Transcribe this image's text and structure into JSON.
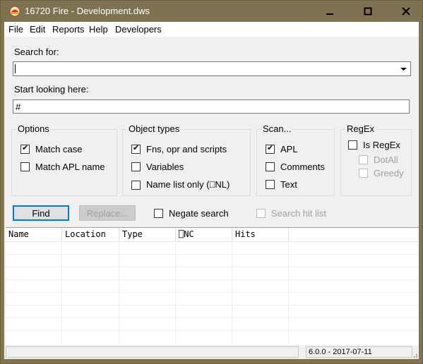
{
  "window": {
    "title": "16720 Fire - Development.dws"
  },
  "menu": {
    "items": [
      "File",
      "Edit",
      "Reports",
      "Help",
      "Developers"
    ]
  },
  "search": {
    "label": "Search for:",
    "value": ""
  },
  "start": {
    "label": "Start looking here:",
    "value": "#"
  },
  "options": {
    "title": "Options",
    "match_case": "Match case",
    "match_apl_name": "Match APL name",
    "match_case_checked": true,
    "match_apl_name_checked": false
  },
  "object_types": {
    "title": "Object types",
    "fns": "Fns, opr and scripts",
    "variables": "Variables",
    "namelist": "Name list only (⎕NL)",
    "fns_checked": true,
    "variables_checked": false,
    "namelist_checked": false
  },
  "scan": {
    "title": "Scan...",
    "apl": "APL",
    "comments": "Comments",
    "text": "Text",
    "apl_checked": true,
    "comments_checked": false,
    "text_checked": false
  },
  "regex": {
    "title": "RegEx",
    "is_regex": "Is RegEx",
    "dotall": "DotAll",
    "greedy": "Greedy",
    "is_regex_checked": false
  },
  "actions": {
    "find": "Find",
    "replace": "Replace...",
    "negate": "Negate search",
    "search_hit_list": "Search hit list"
  },
  "results": {
    "columns": [
      "Name",
      "Location",
      "Type",
      "⎕NC",
      "Hits"
    ]
  },
  "status": {
    "left": "",
    "version": "6.0.0 - 2017-07-11"
  },
  "colors": {
    "titlebar": "#7e7350",
    "focus": "#0078d7"
  }
}
